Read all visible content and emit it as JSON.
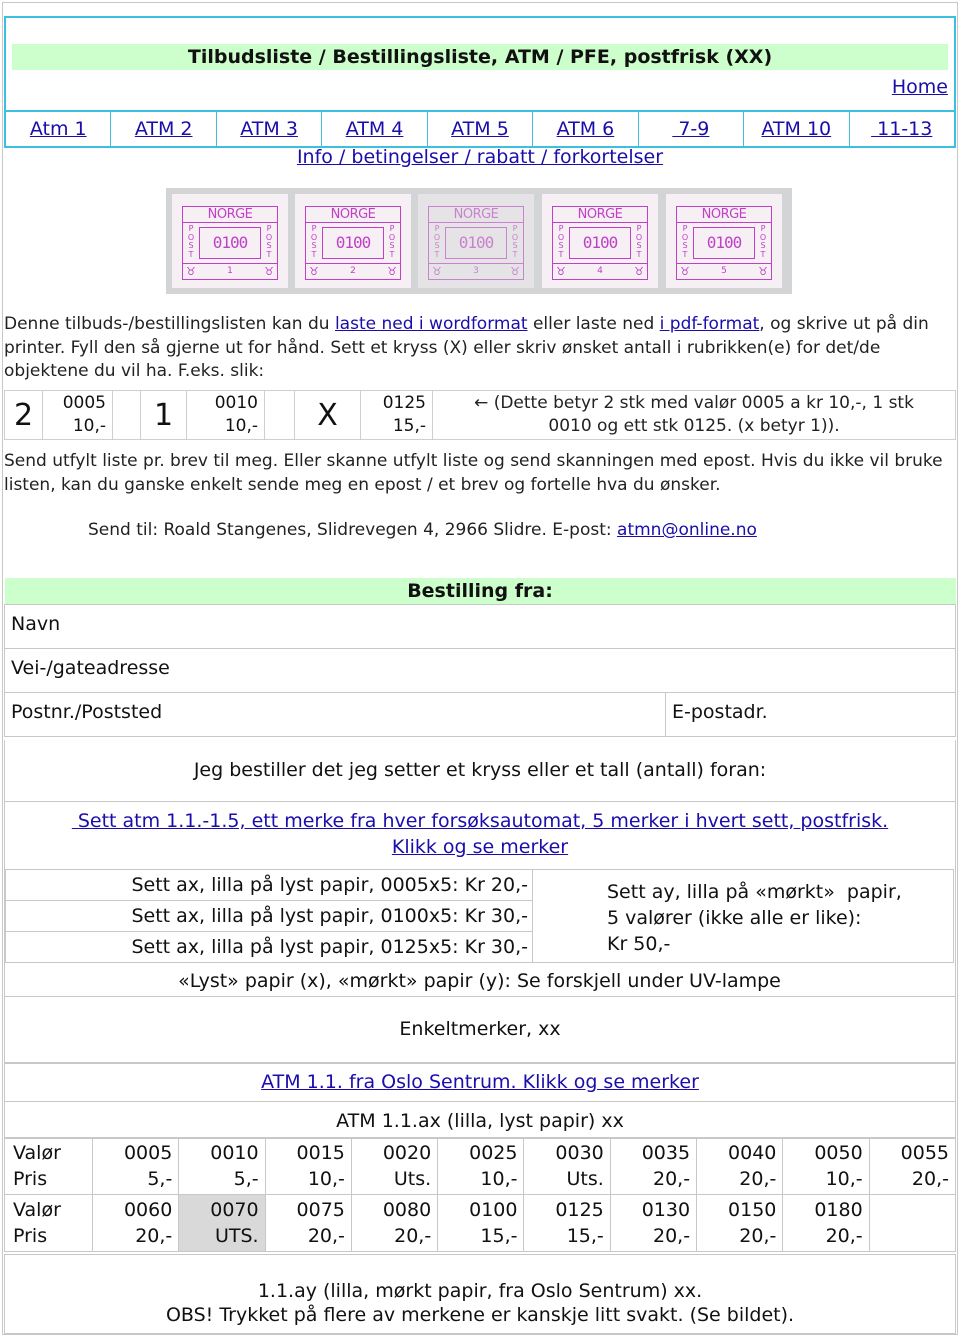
{
  "header": {
    "title": "Tilbudsliste / Bestillingsliste, ATM / PFE, postfrisk (XX)",
    "home_link": "Home",
    "accent_border": "#3cbfe0",
    "title_bg": "#ccffcc"
  },
  "nav": {
    "items": [
      {
        "label": "Atm 1"
      },
      {
        "label": "ATM 2"
      },
      {
        "label": "ATM 3"
      },
      {
        "label": "ATM 4"
      },
      {
        "label": "ATM 5"
      },
      {
        "label": "ATM 6"
      },
      {
        "label": " 7-9"
      },
      {
        "label": "ATM 10"
      },
      {
        "label": " 11-13"
      }
    ]
  },
  "info_link": "Info / betingelser / rabatt / forkortelser",
  "stamp_strip": {
    "stamps": [
      {
        "country": "NORGE",
        "value": "0100",
        "number": "1",
        "side": "POST"
      },
      {
        "country": "NORGE",
        "value": "0100",
        "number": "2",
        "side": "POST"
      },
      {
        "country": "NORGE",
        "value": "0100",
        "number": "3",
        "side": "POST"
      },
      {
        "country": "NORGE",
        "value": "0100",
        "number": "4",
        "side": "POST"
      },
      {
        "country": "NORGE",
        "value": "0100",
        "number": "5",
        "side": "POST"
      }
    ]
  },
  "intro": {
    "part1": "Denne tilbuds-/bestillingslisten kan du ",
    "link_word": "laste ned i wordformat",
    "part2": " eller laste ned ",
    "link_pdf": "i pdf-format",
    "part3": ", og skrive ut på din printer. Fyll den så gjerne ut for hånd. Sett et kryss (X) eller skriv ønsket antall i rubrikken(e) for det/de objektene du vil ha. F.eks. slik:"
  },
  "example": {
    "entries": [
      {
        "mark": "2",
        "value": "0005",
        "price": "10,-"
      },
      {
        "mark": "1",
        "value": "0010",
        "price": "10,-"
      },
      {
        "mark": "X",
        "value": "0125",
        "price": "15,-"
      }
    ],
    "note_line1": "← (Dette betyr 2 stk med valør 0005 a kr 10,-, 1 stk",
    "note_line2": "0010 og ett stk 0125. (x betyr 1))."
  },
  "instructions": {
    "text": "Send utfylt liste pr. brev til meg. Eller skanne utfylt liste og send skanningen med epost. Hvis du ikke vil bruke listen, kan du ganske enkelt sende meg en epost / et brev og fortelle hva du ønsker.",
    "send_to": "Send til: Roald Stangenes, Slidrevegen 4, 2966 Slidre. E-post: ",
    "email": "atmn@online.no"
  },
  "order_form": {
    "heading": "Bestilling fra:",
    "name_label": "Navn",
    "address_label": "Vei-/gateadresse",
    "postal_label": "Postnr./Poststed",
    "email_label": "E-postadr.",
    "order_statement": "Jeg bestiller det jeg setter et kryss eller et tall (antall) foran:"
  },
  "sets": {
    "link_line1": " Sett atm 1.1.-1.5, ett merke fra hver forsøksautomat, 5 merker i hvert sett, postfrisk.",
    "link_line2": "Klikk og se merker",
    "ax_sets": [
      "Sett ax, lilla på lyst papir, 0005x5: Kr 20,-",
      "Sett ax, lilla på lyst papir, 0100x5: Kr 30,-",
      "Sett ax, lilla på lyst papir, 0125x5: Kr 30,-"
    ],
    "ay_set_line1": "Sett ay, lilla på «mørkt»  papir,",
    "ay_set_line2": "5 valører (ikke alle er like):",
    "ay_set_line3": "Kr 50,-",
    "uv_note": "«Lyst» papir (x), «mørkt» papir (y): Se forskjell under UV-lampe"
  },
  "singles": {
    "heading": "Enkeltmerker, xx",
    "oslo_link": "ATM 1.1. fra Oslo Sentrum. Klikk og se merker",
    "ax_heading": "ATM 1.1.ax (lilla, lyst papir) xx",
    "label_value": "Valør",
    "label_price": "Pris",
    "row1": [
      {
        "value": "0005",
        "price": "5,-"
      },
      {
        "value": "0010",
        "price": "5,-"
      },
      {
        "value": "0015",
        "price": "10,-"
      },
      {
        "value": "0020",
        "price": "Uts."
      },
      {
        "value": "0025",
        "price": "10,-"
      },
      {
        "value": "0030",
        "price": "Uts."
      },
      {
        "value": "0035",
        "price": "20,-"
      },
      {
        "value": "0040",
        "price": "20,-"
      },
      {
        "value": "0050",
        "price": "10,-"
      },
      {
        "value": "0055",
        "price": "20,-"
      }
    ],
    "row2": [
      {
        "value": "0060",
        "price": "20,-"
      },
      {
        "value": "0070",
        "price": "UTS.",
        "sold_out_shading": true
      },
      {
        "value": "0075",
        "price": "20,-"
      },
      {
        "value": "0080",
        "price": "20,-"
      },
      {
        "value": "0100",
        "price": "15,-"
      },
      {
        "value": "0125",
        "price": "15,-"
      },
      {
        "value": "0130",
        "price": "20,-"
      },
      {
        "value": "0150",
        "price": "20,-"
      },
      {
        "value": "0180",
        "price": "20,-"
      },
      {
        "value": "",
        "price": ""
      }
    ],
    "ay_line1": "1.1.ay (lilla, mørkt papir, fra Oslo Sentrum) xx.",
    "ay_line2": "OBS! Trykket på flere av merkene er kanskje litt svakt. (Se bildet)."
  }
}
